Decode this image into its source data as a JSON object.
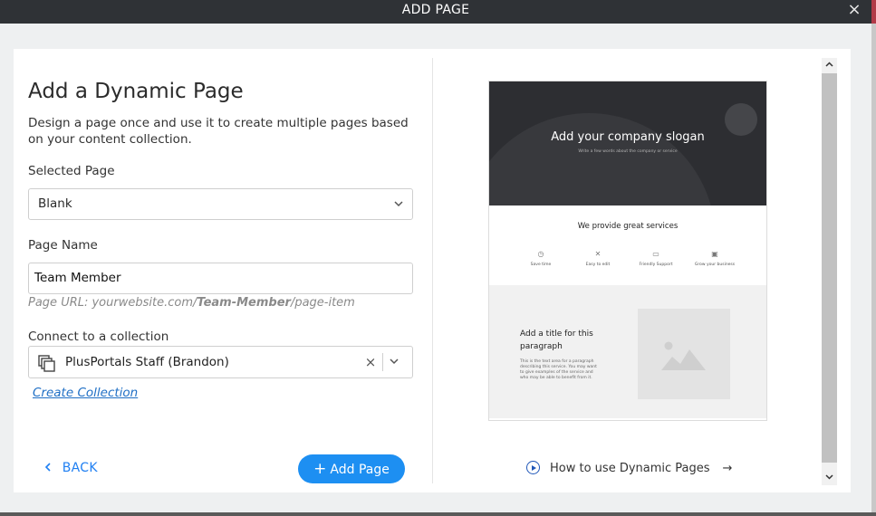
{
  "window": {
    "title": "ADD PAGE",
    "close_icon": "×"
  },
  "form": {
    "heading": "Add a Dynamic Page",
    "description": "Design a page once and use it to create multiple pages based on your content collection.",
    "selected_page": {
      "label": "Selected Page",
      "value": "Blank"
    },
    "page_name": {
      "label": "Page Name",
      "value": "Team Member"
    },
    "url_hint": {
      "prefix": "Page URL: yourwebsite.com/",
      "slug": "Team-Member",
      "suffix": "/page-item"
    },
    "collection": {
      "label": "Connect to a collection",
      "value": "PlusPortals Staff (Brandon)",
      "clear": "×"
    },
    "create_collection": "Create Collection",
    "back": "BACK",
    "add_page": "Add Page"
  },
  "preview": {
    "slogan": "Add your company slogan",
    "slogan_sub": "Write a few words about the company or service",
    "services_title": "We provide great services",
    "services": [
      {
        "label": "Save time",
        "icon": "clock-icon"
      },
      {
        "label": "Easy to edit",
        "icon": "tools-icon"
      },
      {
        "label": "Friendly Support",
        "icon": "chat-icon"
      },
      {
        "label": "Grow your business",
        "icon": "chart-icon"
      }
    ],
    "para_title": "Add a title for this paragraph",
    "para_body": "This is the text area for a paragraph describing this service. You may want to give examples of the service and who may be able to benefit from it."
  },
  "help_link": "How to use Dynamic Pages",
  "colors": {
    "accent": "#1d8ff2",
    "titlebar": "#2f3236",
    "link": "#1f6fc5"
  }
}
